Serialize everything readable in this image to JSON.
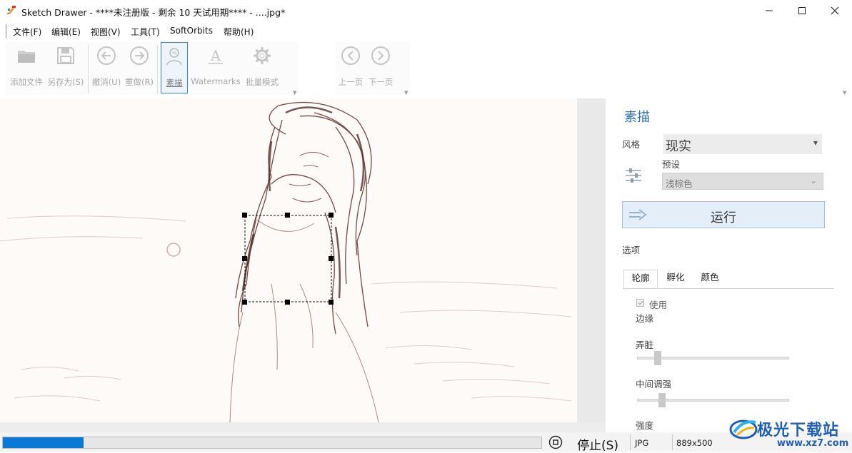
{
  "window": {
    "title": "Sketch Drawer - ****未注册版 - 剩余 10 天试用期**** - ....jpg*",
    "controls": [
      "minimize",
      "maximize",
      "close"
    ]
  },
  "menu": {
    "items": [
      "文件(F)",
      "编辑(E)",
      "视图(V)",
      "工具(T)",
      "SoftOrbits",
      "帮助(H)"
    ]
  },
  "toolbar": {
    "add_file": "添加文件",
    "save_as": "另存为(S)",
    "undo": "撤消(U)",
    "redo": "重做(R)",
    "sketch": "素描",
    "watermarks": "Watermarks",
    "batch_mode": "批量模式",
    "prev_page": "上一页",
    "next_page": "下一页"
  },
  "panel": {
    "title": "素描",
    "style_label": "风格",
    "style_value": "现实",
    "preset_label": "预设",
    "preset_value": "浅棕色",
    "run_button": "运行",
    "options_label": "选项",
    "tabs": [
      "轮廓",
      "孵化",
      "颜色"
    ],
    "active_tab": "轮廓",
    "use_checkbox": {
      "label": "使用",
      "checked": true
    },
    "edge_label": "边缘",
    "sliders": [
      {
        "label": "弄脏",
        "value": 0.12
      },
      {
        "label": "中间调强",
        "value": 0.15
      }
    ],
    "strength_label": "强度"
  },
  "status": {
    "progress": 0.15,
    "stop_label": "停止(S)",
    "format": "JPG",
    "dimensions": "889x500"
  },
  "watermark": {
    "text": "极光下载站",
    "url": "www.xz7.com"
  },
  "colors": {
    "accent": "#0a78d7",
    "panel_title": "#2f6fb2",
    "sketch_stroke": "#5a2a22",
    "disabled_icon": "#c4c4c4"
  }
}
